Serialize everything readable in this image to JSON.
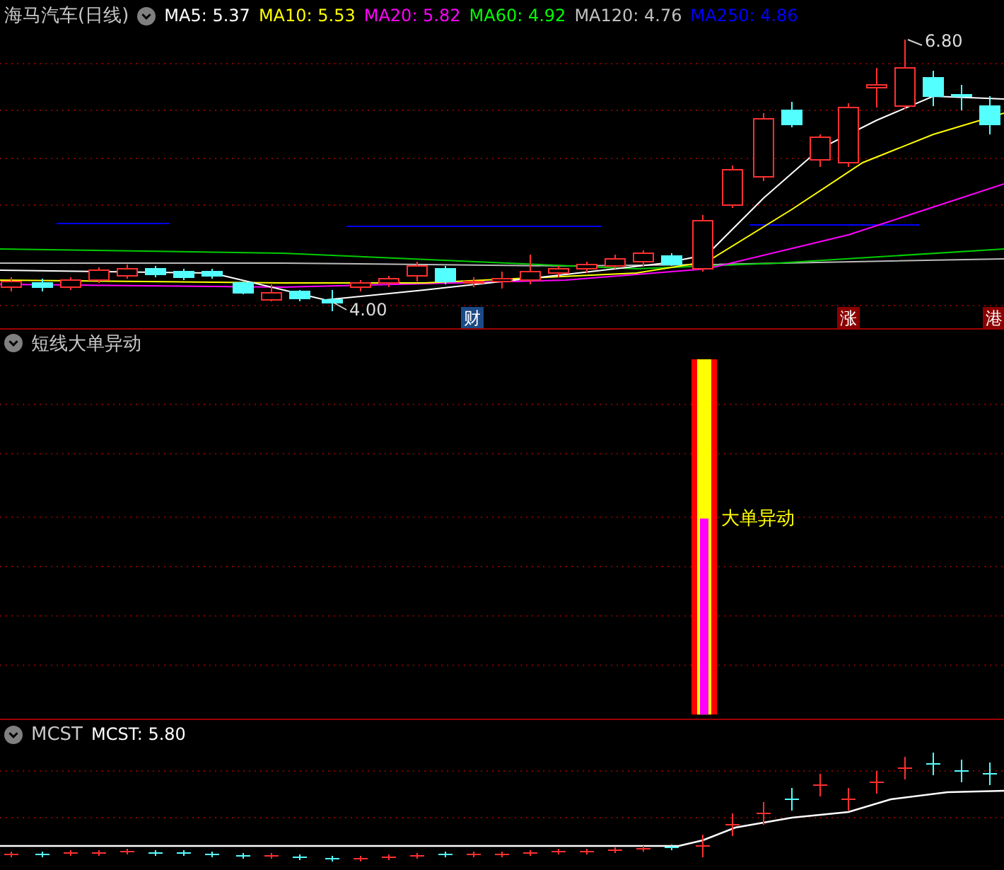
{
  "main_panel": {
    "title": "海马汽车(日线)",
    "indicators": [
      {
        "label": "MA5: 5.37",
        "color": "#ffffff"
      },
      {
        "label": "MA10: 5.53",
        "color": "#ffff00"
      },
      {
        "label": "MA20: 5.82",
        "color": "#ff00ff"
      },
      {
        "label": "MA60: 4.92",
        "color": "#00ff00"
      },
      {
        "label": "MA120: 4.76",
        "color": "#c0c0c0"
      },
      {
        "label": "MA250: 4.86",
        "color": "#0000ff"
      }
    ],
    "high_label": "6.80",
    "low_label": "4.00",
    "event_markers": [
      {
        "text": "财",
        "color": "#1c4a86"
      },
      {
        "text": "涨",
        "color": "#8a0000"
      },
      {
        "text": "港",
        "color": "#8a0000"
      }
    ]
  },
  "signal_panel": {
    "title": "短线大单异动",
    "signal_label": "大单异动"
  },
  "cost_panel": {
    "title": "MCST",
    "indicator": "MCST: 5.80"
  }
}
